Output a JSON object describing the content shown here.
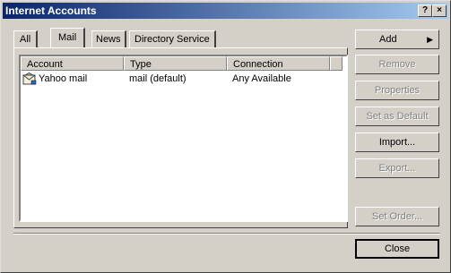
{
  "window": {
    "title": "Internet Accounts",
    "help_label": "?",
    "close_label": "×"
  },
  "tabs": [
    {
      "label": "All",
      "active": false
    },
    {
      "label": "Mail",
      "active": true
    },
    {
      "label": "News",
      "active": false
    },
    {
      "label": "Directory Service",
      "active": false
    }
  ],
  "list": {
    "columns": [
      "Account",
      "Type",
      "Connection"
    ],
    "rows": [
      {
        "icon": "mail-account-icon",
        "account": "Yahoo mail",
        "type": "mail (default)",
        "connection": "Any Available"
      }
    ]
  },
  "buttons": {
    "add": "Add",
    "add_arrow": "▶",
    "remove": "Remove",
    "properties": "Properties",
    "set_default": "Set as Default",
    "import": "Import...",
    "export": "Export...",
    "set_order": "Set Order...",
    "close": "Close"
  },
  "colors": {
    "titlebar_start": "#0a246a",
    "titlebar_end": "#a6caf0",
    "face": "#d4d0c8"
  }
}
